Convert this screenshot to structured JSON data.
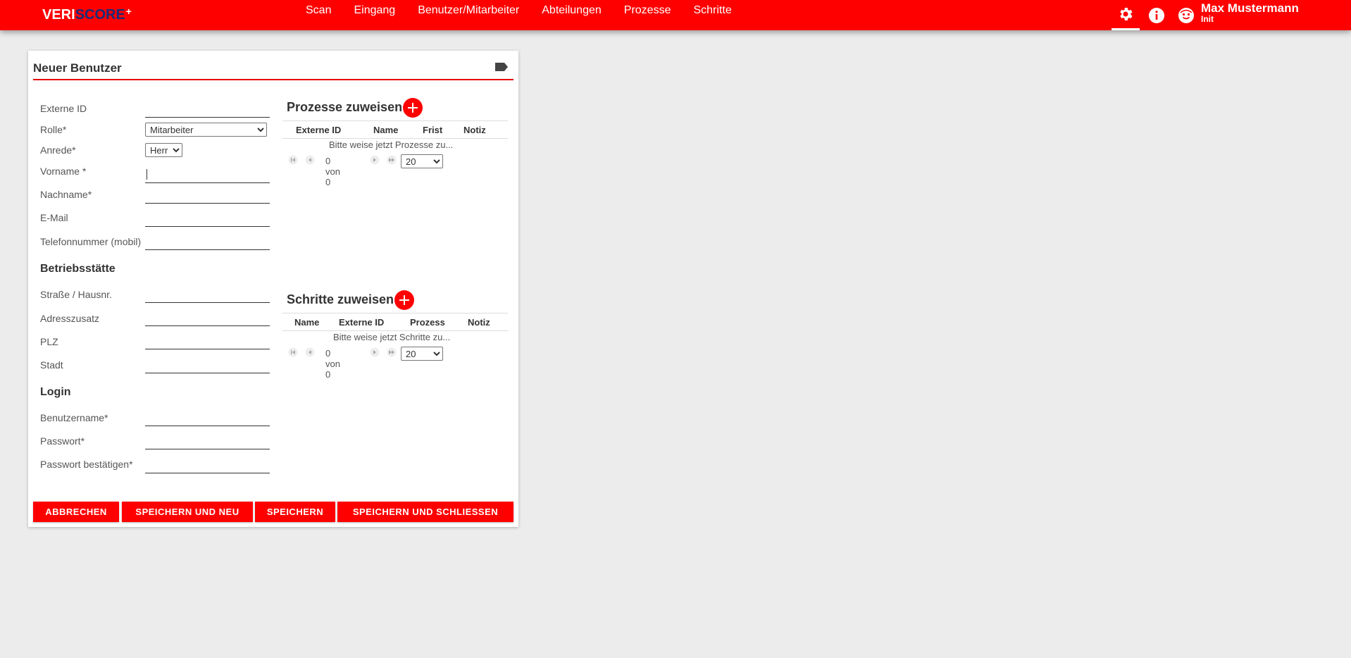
{
  "app": {
    "logo_part1": "VERI",
    "logo_part2": "SCORE",
    "logo_plus": "+",
    "brand_color": "#ff0000"
  },
  "nav": {
    "items": [
      "Scan",
      "Eingang",
      "Benutzer/Mitarbeiter",
      "Abteilungen",
      "Prozesse",
      "Schritte"
    ]
  },
  "header_icons": [
    "gear-icon",
    "info-icon",
    "user-face-icon"
  ],
  "user": {
    "name": "Max Mustermann",
    "subtitle": "Init"
  },
  "form": {
    "title": "Neuer Benutzer",
    "externe_id_label": "Externe ID",
    "externe_id_value": "",
    "rolle_label": "Rolle*",
    "rolle_value": "Mitarbeiter",
    "anrede_label": "Anrede*",
    "anrede_value": "Herr",
    "vorname_label": "Vorname *",
    "nachname_label": "Nachname*",
    "email_label": "E-Mail",
    "telefon_label": "Telefonnummer (mobil)",
    "betriebsstaette_heading": "Betriebsstätte",
    "strasse_label": "Straße / Hausnr.",
    "adresszusatz_label": "Adresszusatz",
    "plz_label": "PLZ",
    "stadt_label": "Stadt",
    "login_heading": "Login",
    "benutzername_label": "Benutzername*",
    "passwort_label": "Passwort*",
    "passwort_bestaetigen_label": "Passwort bestätigen*"
  },
  "prozesse": {
    "heading": "Prozesse zuweisen",
    "columns": [
      "Externe ID",
      "Name",
      "Frist",
      "Notiz"
    ],
    "empty": "Bitte weise jetzt Prozesse zu...",
    "pager_text": "0 von 0",
    "page_size": "20"
  },
  "schritte": {
    "heading": "Schritte zuweisen",
    "columns": [
      "Name",
      "Externe ID",
      "Prozess",
      "Notiz"
    ],
    "empty": "Bitte weise jetzt Schritte zu...",
    "pager_text": "0 von 0",
    "page_size": "20"
  },
  "buttons": {
    "abbrechen": "ABBRECHEN",
    "speichern_neu": "SPEICHERN UND NEU",
    "speichern": "SPEICHERN",
    "speichern_schliessen": "SPEICHERN UND SCHLIESSEN"
  }
}
